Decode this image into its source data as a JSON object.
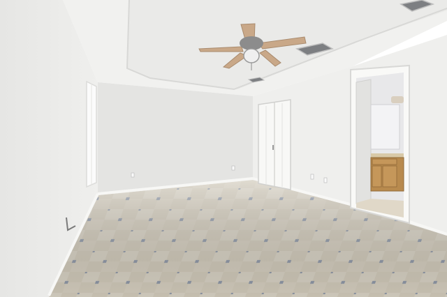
{
  "scene": {
    "colors": {
      "wall_left": "#e9e9e7",
      "wall_back": "#e4e4e2",
      "wall_right": "#efefed",
      "ceiling": "#f1f1ef",
      "ceiling_tray": "#e7e7e5",
      "floor": "#cfc8b8",
      "floor_tile_dot": "#8e97a6",
      "baseboard": "#f7f7f5",
      "fan_blade": "#c9a888",
      "fan_body": "#8c8c8c",
      "vent": "#7d7f82",
      "window_light": "#fbfbfb",
      "cabinet": "#b88a4e",
      "counter": "#d8c9a8",
      "bath_wall": "#e8e8ea",
      "mirror": "#f3f3f5"
    },
    "objects": {
      "ceiling_fan": "ceiling-fan",
      "window": "window",
      "closet": "bifold-closet-doors",
      "doorway": "bathroom-doorway",
      "vanity": "bathroom-vanity",
      "vents": "ceiling-vents",
      "outlets": "wall-outlets"
    }
  }
}
